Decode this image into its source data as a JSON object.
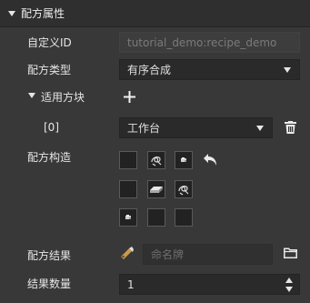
{
  "section": {
    "title": "配方属性"
  },
  "custom_id": {
    "label": "自定义ID",
    "value": "tutorial_demo:recipe_demo"
  },
  "recipe_type": {
    "label": "配方类型",
    "value": "有序合成"
  },
  "applicable_blocks": {
    "label": "适用方块",
    "add_icon": "plus-icon"
  },
  "block_entry": {
    "index_label": "[0]",
    "value": "工作台",
    "delete_icon": "trash-icon"
  },
  "recipe_structure": {
    "label": "配方构造",
    "grid": [
      [
        "empty",
        "string",
        "iron-nugget"
      ],
      [
        "empty",
        "iron-ingot",
        "string"
      ],
      [
        "iron-nugget",
        "empty",
        "empty"
      ]
    ],
    "undo_icon": "undo-icon"
  },
  "recipe_result": {
    "label": "配方结果",
    "item_icon": "name-tag-icon",
    "placeholder": "命名牌",
    "folder_icon": "folder-icon"
  },
  "result_count": {
    "label": "结果数量",
    "value": "1"
  },
  "colors": {
    "background": "#383838",
    "header": "#2f2f2f",
    "field": "#2a2a2a",
    "disabled_field": "#3d3d3d"
  }
}
